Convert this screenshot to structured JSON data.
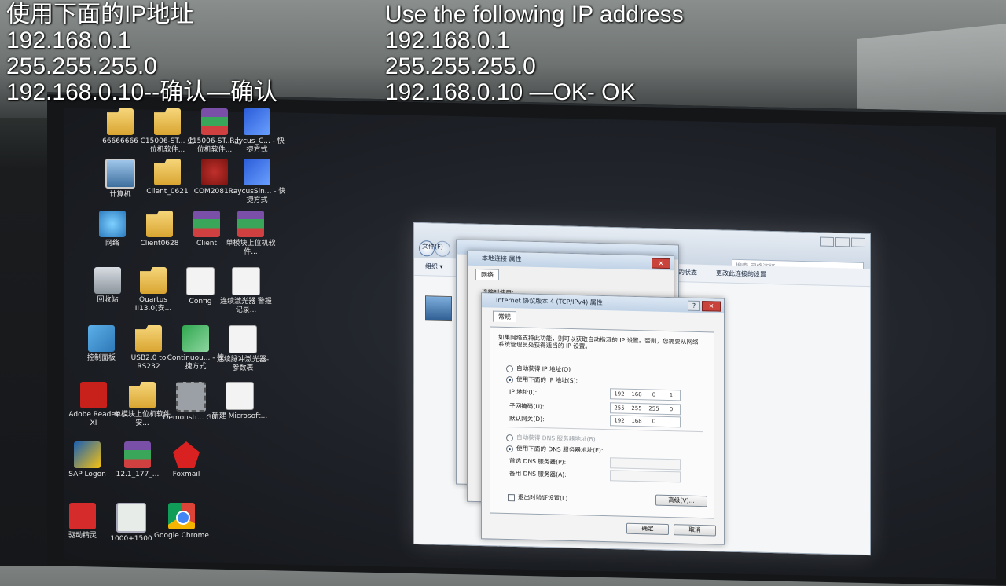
{
  "captions": {
    "chinese": {
      "line1": "使用下面的IP地址",
      "line2": "192.168.0.1",
      "line3": "255.255.255.0",
      "line4": "192.168.0.10--确认—确认"
    },
    "english": {
      "line1": "Use the following IP address",
      "line2": "192.168.0.1",
      "line3": "255.255.255.0",
      "line4": "192.168.0.10 —OK- OK"
    }
  },
  "desktop_icons": [
    {
      "id": "i1",
      "label": "66666666",
      "icon": "folder-icon"
    },
    {
      "id": "i2",
      "label": "C15006-ST... 上位机软件...",
      "icon": "folder-icon"
    },
    {
      "id": "i3",
      "label": "C15006-ST... 上位机软件...",
      "icon": "rar-icon"
    },
    {
      "id": "i4",
      "label": "Raycus_C... - 快捷方式",
      "icon": "app-icon"
    },
    {
      "id": "i5",
      "label": "计算机",
      "icon": "computer-icon"
    },
    {
      "id": "i6",
      "label": "Client_0621",
      "icon": "folder-icon"
    },
    {
      "id": "i7",
      "label": "COM2081...",
      "icon": "red-app-icon"
    },
    {
      "id": "i8",
      "label": "RaycusSin... - 快捷方式",
      "icon": "app-icon"
    },
    {
      "id": "i9",
      "label": "网络",
      "icon": "network-icon"
    },
    {
      "id": "i10",
      "label": "Client0628",
      "icon": "folder-icon"
    },
    {
      "id": "i11",
      "label": "Client",
      "icon": "rar-icon"
    },
    {
      "id": "i12",
      "label": "单模块上位机软件...",
      "icon": "rar-icon"
    },
    {
      "id": "i13",
      "label": "回收站",
      "icon": "recycle-bin-icon"
    },
    {
      "id": "i14",
      "label": "Quartus II13.0(安...",
      "icon": "folder-icon"
    },
    {
      "id": "i15",
      "label": "Config",
      "icon": "document-icon"
    },
    {
      "id": "i16",
      "label": "连续激光器 警报记录...",
      "icon": "document-icon"
    },
    {
      "id": "i17",
      "label": "控制面板",
      "icon": "control-panel-icon"
    },
    {
      "id": "i18",
      "label": "USB2.0 to RS232",
      "icon": "folder-icon"
    },
    {
      "id": "i19",
      "label": "Continuou... - 快捷方式",
      "icon": "green-app-icon"
    },
    {
      "id": "i20",
      "label": "连续脉冲激光器-参数表",
      "icon": "document-icon"
    },
    {
      "id": "i21",
      "label": "Adobe Reader XI",
      "icon": "pdf-icon"
    },
    {
      "id": "i22",
      "label": "单模块上位机软件安...",
      "icon": "folder-icon"
    },
    {
      "id": "i23",
      "label": "Demonstr... GUI",
      "icon": "chip-icon"
    },
    {
      "id": "i24",
      "label": "新建 Microsoft...",
      "icon": "document-icon"
    },
    {
      "id": "i25",
      "label": "SAP Logon",
      "icon": "sap-icon"
    },
    {
      "id": "i26",
      "label": "12.1_177_...",
      "icon": "rar-icon"
    },
    {
      "id": "i27",
      "label": "Foxmail",
      "icon": "foxmail-icon"
    },
    {
      "id": "i28",
      "label": "驱动精灵",
      "icon": "driver-icon"
    },
    {
      "id": "i29",
      "label": "1000+1500",
      "icon": "window-icon"
    },
    {
      "id": "i30",
      "label": "Google Chrome",
      "icon": "chrome-icon"
    }
  ],
  "explorer": {
    "search_placeholder": "搜索 网络连接",
    "menu_file": "文件(F)",
    "menu_organize": "组织 ▾",
    "status_action": "的状态",
    "rename_action": "更改此连接的设置"
  },
  "back_dialog": {
    "title": "本地连接 属性",
    "tab": "网络",
    "connect_label": "连接时使用:"
  },
  "ipv4_dialog": {
    "title": "Internet 协议版本 4 (TCP/IPv4) 属性",
    "help_button": "?",
    "close_button": "✕",
    "tab_general": "常规",
    "description": "如果网络支持此功能，则可以获取自动指派的 IP 设置。否则，您需要从网络系统管理员处获得适当的 IP 设置。",
    "auto_ip": "自动获得 IP 地址(O)",
    "manual_ip": "使用下面的 IP 地址(S):",
    "ip_label": "IP 地址(I):",
    "ip_value": [
      "192",
      "168",
      "0",
      "1"
    ],
    "mask_label": "子网掩码(U):",
    "mask_value": [
      "255",
      "255",
      "255",
      "0"
    ],
    "gateway_label": "默认网关(D):",
    "gateway_value": [
      "192",
      "168",
      "0",
      ""
    ],
    "auto_dns": "自动获得 DNS 服务器地址(B)",
    "manual_dns": "使用下面的 DNS 服务器地址(E):",
    "preferred_dns": "首选 DNS 服务器(P):",
    "alternate_dns": "备用 DNS 服务器(A):",
    "validate": "退出时验证设置(L)",
    "advanced": "高级(V)...",
    "ok": "确定",
    "cancel": "取消",
    "selected_mode": "manual"
  }
}
